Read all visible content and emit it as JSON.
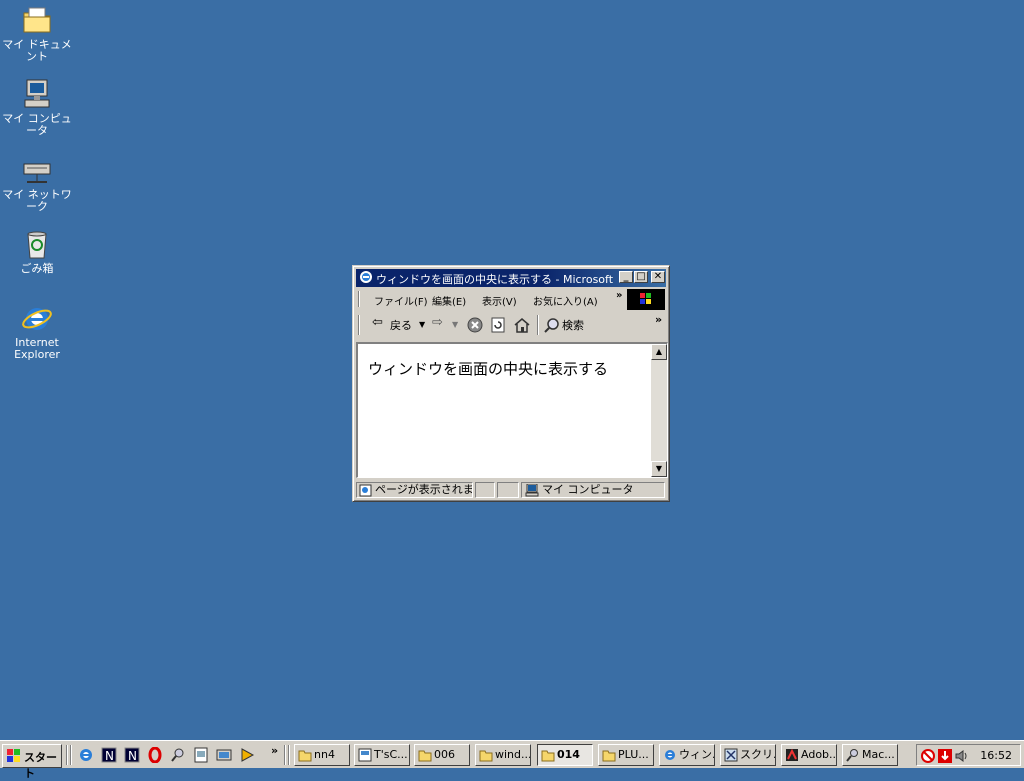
{
  "desktop": {
    "background_color": "#3a6ea5",
    "icons": [
      {
        "label": "マイ ドキュメント",
        "icon": "folder-documents-icon"
      },
      {
        "label": "マイ コンピュータ",
        "icon": "computer-icon"
      },
      {
        "label": "マイ ネットワーク",
        "icon": "network-icon"
      },
      {
        "label": "ごみ箱",
        "icon": "recycle-bin-icon"
      },
      {
        "label": "Internet Explorer",
        "icon": "ie-icon"
      }
    ]
  },
  "window": {
    "title": "ウィンドウを画面の中央に表示する - Microsoft I...",
    "menu": {
      "file": "ファイル(F)",
      "edit": "編集(E)",
      "view": "表示(V)",
      "favorites": "お気に入り(A)",
      "more": "»"
    },
    "toolbar": {
      "back": "戻る",
      "search": "検索",
      "more": "»"
    },
    "content_text": "ウィンドウを画面の中央に表示する",
    "status": {
      "message": "ページが表示されました",
      "zone": "マイ コンピュータ"
    }
  },
  "taskbar": {
    "start_label": "スタート",
    "quicklaunch_more": "»",
    "tasks": [
      {
        "label": "nn4",
        "icon": "folder-icon"
      },
      {
        "label": "T'sC...",
        "icon": "app-icon"
      },
      {
        "label": "006",
        "icon": "folder-icon"
      },
      {
        "label": "wind...",
        "icon": "folder-icon"
      },
      {
        "label": "014",
        "icon": "folder-icon",
        "active": true
      },
      {
        "label": "PLU...",
        "icon": "folder-icon"
      },
      {
        "label": "ウィン...",
        "icon": "ie-icon"
      },
      {
        "label": "スクリ...",
        "icon": "script-icon"
      },
      {
        "label": "Adob...",
        "icon": "adobe-icon"
      },
      {
        "label": "Mac...",
        "icon": "search-app-icon"
      }
    ],
    "clock": "16:52"
  }
}
